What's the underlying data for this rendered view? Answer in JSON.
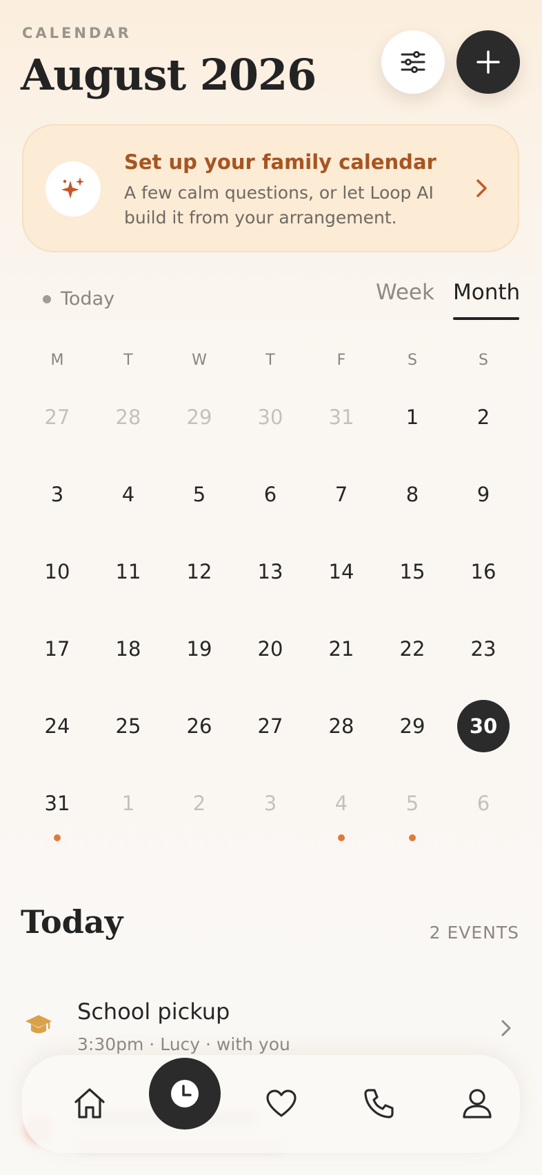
{
  "header": {
    "eyebrow": "CALENDAR",
    "title": "August 2026",
    "filter_icon": "sliders-icon",
    "add_icon": "plus-icon"
  },
  "banner": {
    "title": "Set up your family calendar",
    "description": "A few calm questions, or let Loop AI build it from your arrangement.",
    "icon": "sparkles-icon"
  },
  "view_controls": {
    "today_label": "Today",
    "week_label": "Week",
    "month_label": "Month",
    "active": "Month"
  },
  "calendar": {
    "weekdays": [
      "M",
      "T",
      "W",
      "T",
      "F",
      "S",
      "S"
    ],
    "days": [
      {
        "label": "27",
        "muted": true
      },
      {
        "label": "28",
        "muted": true
      },
      {
        "label": "29",
        "muted": true
      },
      {
        "label": "30",
        "muted": true
      },
      {
        "label": "31",
        "muted": true
      },
      {
        "label": "1"
      },
      {
        "label": "2"
      },
      {
        "label": "3"
      },
      {
        "label": "4"
      },
      {
        "label": "5"
      },
      {
        "label": "6"
      },
      {
        "label": "7"
      },
      {
        "label": "8"
      },
      {
        "label": "9"
      },
      {
        "label": "10"
      },
      {
        "label": "11"
      },
      {
        "label": "12"
      },
      {
        "label": "13"
      },
      {
        "label": "14"
      },
      {
        "label": "15"
      },
      {
        "label": "16"
      },
      {
        "label": "17"
      },
      {
        "label": "18"
      },
      {
        "label": "19"
      },
      {
        "label": "20"
      },
      {
        "label": "21"
      },
      {
        "label": "22"
      },
      {
        "label": "23"
      },
      {
        "label": "24"
      },
      {
        "label": "25"
      },
      {
        "label": "26"
      },
      {
        "label": "27"
      },
      {
        "label": "28"
      },
      {
        "label": "29"
      },
      {
        "label": "30",
        "selected": true
      },
      {
        "label": "31",
        "event": true
      },
      {
        "label": "1",
        "muted": true
      },
      {
        "label": "2",
        "muted": true
      },
      {
        "label": "3",
        "muted": true
      },
      {
        "label": "4",
        "muted": true,
        "event": true
      },
      {
        "label": "5",
        "muted": true,
        "event": true
      },
      {
        "label": "6",
        "muted": true
      }
    ]
  },
  "today_section": {
    "title": "Today",
    "count": "2 EVENTS",
    "events": [
      {
        "title": "School pickup",
        "subtitle": "3:30pm · Lucy · with you",
        "icon": "graduation-cap-icon"
      }
    ]
  },
  "tabbar": {
    "items": [
      {
        "name": "home",
        "icon": "home-icon"
      },
      {
        "name": "schedule",
        "icon": "clock-icon",
        "active": true
      },
      {
        "name": "favorites",
        "icon": "heart-icon"
      },
      {
        "name": "calls",
        "icon": "phone-icon"
      },
      {
        "name": "profile",
        "icon": "user-icon"
      }
    ]
  },
  "colors": {
    "accent": "#a65521",
    "event_dot": "#e07a3a",
    "dark": "#2b2b2b"
  }
}
